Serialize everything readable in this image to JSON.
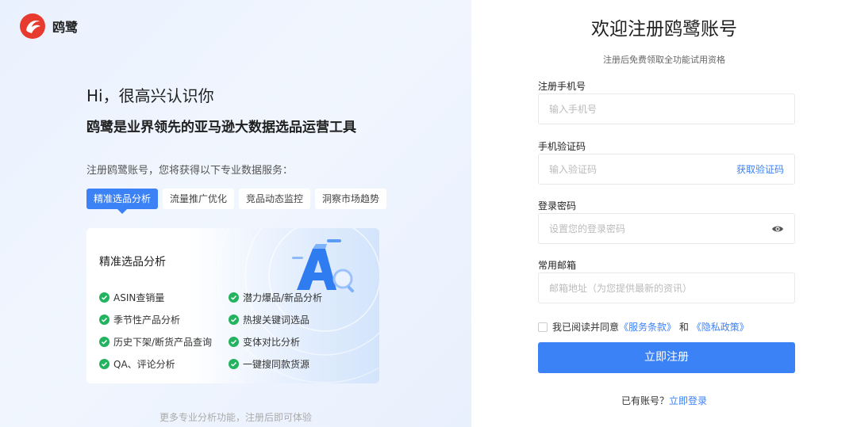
{
  "brand": {
    "name": "鸥鹭",
    "accent": "#e63b2e"
  },
  "left": {
    "greeting": "Hi，很高兴认识你",
    "tagline": "鸥鹭是业界领先的亚马逊大数据选品运营工具",
    "intro": "注册鸥鹭账号，您将获得以下专业数据服务：",
    "tabs": [
      {
        "label": "精准选品分析",
        "active": true
      },
      {
        "label": "流量推广优化",
        "active": false
      },
      {
        "label": "竞品动态监控",
        "active": false
      },
      {
        "label": "洞察市场趋势",
        "active": false
      }
    ],
    "card": {
      "title": "精准选品分析",
      "features": [
        "ASIN查销量",
        "潜力爆品/新品分析",
        "季节性产品分析",
        "热搜关键词选品",
        "历史下架/断货产品查询",
        "变体对比分析",
        "QA、评论分析",
        "一键搜同款货源"
      ]
    },
    "more_note": "更多专业分析功能，注册后即可体验"
  },
  "right": {
    "title": "欢迎注册鸥鹭账号",
    "subtitle": "注册后免费领取全功能试用资格",
    "phone": {
      "label": "注册手机号",
      "placeholder": "输入手机号",
      "value": ""
    },
    "code": {
      "label": "手机验证码",
      "placeholder": "输入验证码",
      "value": "",
      "action": "获取验证码"
    },
    "password": {
      "label": "登录密码",
      "placeholder": "设置您的登录密码",
      "value": "",
      "icon": "eye-icon"
    },
    "email": {
      "label": "常用邮箱",
      "placeholder": "邮箱地址（为您提供最新的资讯）",
      "value": ""
    },
    "agreement": {
      "prefix": "我已阅读并同意",
      "terms": "《服务条款》",
      "and": "和",
      "privacy": "《隐私政策》"
    },
    "submit": "立即注册",
    "login": {
      "prompt": "已有账号？",
      "link": "立即登录"
    },
    "accent": "#3b82f6"
  }
}
